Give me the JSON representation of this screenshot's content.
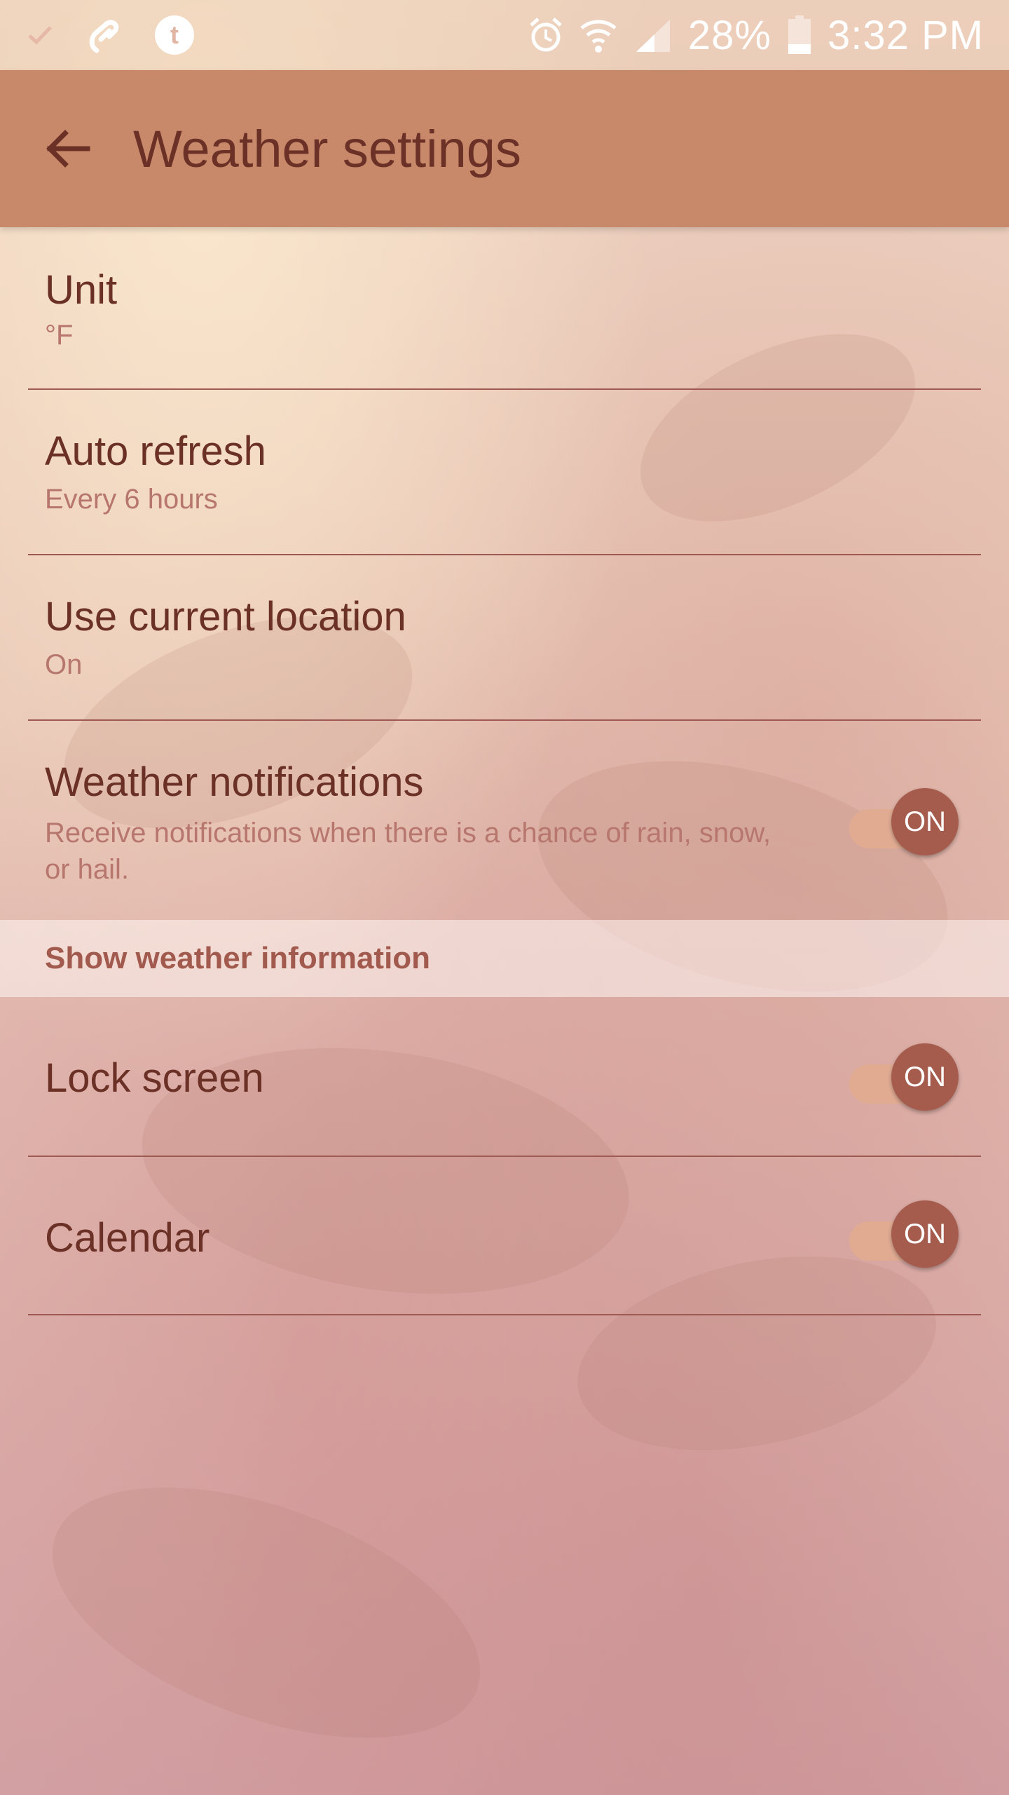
{
  "status_bar": {
    "battery": "28%",
    "time": "3:32 PM",
    "left_icons": [
      "check-icon",
      "link-app-icon",
      "tumblr-icon"
    ],
    "right_icons": [
      "alarm-icon",
      "wifi-icon",
      "signal-icon",
      "battery-icon"
    ],
    "battery_level": 0.28
  },
  "toolbar": {
    "title": "Weather settings",
    "back_icon": "back-arrow-icon"
  },
  "settings": {
    "unit": {
      "title": "Unit",
      "value": "°F"
    },
    "auto_refresh": {
      "title": "Auto refresh",
      "value": "Every 6 hours"
    },
    "location": {
      "title": "Use current location",
      "value": "On"
    },
    "notifications": {
      "title": "Weather notifications",
      "description": "Receive notifications when there is a chance of rain, snow, or hail.",
      "toggle": "ON"
    }
  },
  "section": {
    "header": "Show weather information",
    "lock_screen": {
      "title": "Lock screen",
      "toggle": "ON"
    },
    "calendar": {
      "title": "Calendar",
      "toggle": "ON"
    }
  },
  "colors": {
    "toolbar": "#c8896b",
    "title_text": "#6b3126",
    "accent": "#a55c4d",
    "secondary_text": "#b7766e"
  }
}
